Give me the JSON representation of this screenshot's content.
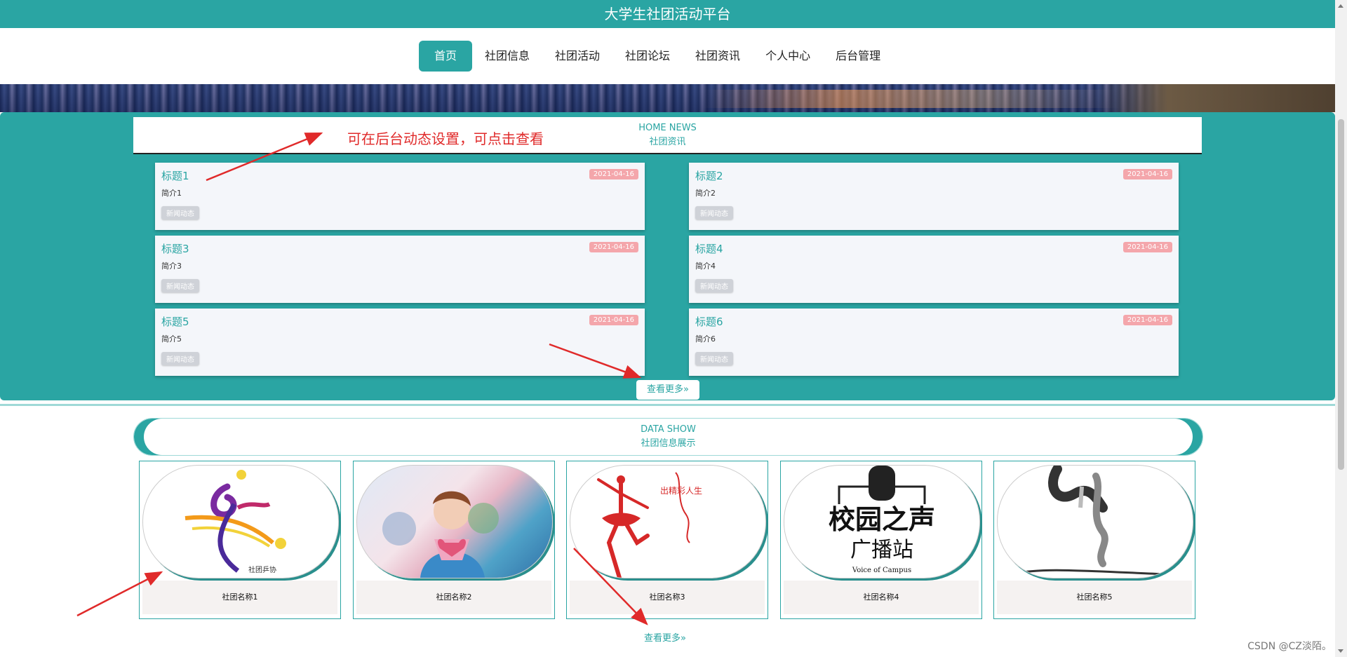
{
  "header": {
    "title": "大学生社团活动平台"
  },
  "nav": {
    "items": [
      {
        "label": "首页",
        "active": true
      },
      {
        "label": "社团信息"
      },
      {
        "label": "社团活动"
      },
      {
        "label": "社团论坛"
      },
      {
        "label": "社团资讯"
      },
      {
        "label": "个人中心"
      },
      {
        "label": "后台管理"
      }
    ]
  },
  "news": {
    "header_en": "HOME NEWS",
    "header_cn": "社团资讯",
    "annotation": "可在后台动态设置，可点击查看",
    "items": [
      {
        "title": "标题1",
        "date": "2021-04-16",
        "summary": "简介1",
        "tag": "新闻动态"
      },
      {
        "title": "标题2",
        "date": "2021-04-16",
        "summary": "简介2",
        "tag": "新闻动态"
      },
      {
        "title": "标题3",
        "date": "2021-04-16",
        "summary": "简介3",
        "tag": "新闻动态"
      },
      {
        "title": "标题4",
        "date": "2021-04-16",
        "summary": "简介4",
        "tag": "新闻动态"
      },
      {
        "title": "标题5",
        "date": "2021-04-16",
        "summary": "简介5",
        "tag": "新闻动态"
      },
      {
        "title": "标题6",
        "date": "2021-04-16",
        "summary": "简介6",
        "tag": "新闻动态"
      }
    ],
    "more_label": "查看更多»"
  },
  "clubs": {
    "header_en": "DATA SHOW",
    "header_cn": "社团信息展示",
    "items": [
      {
        "name": "社团名称1",
        "logo_text": "社团乒协"
      },
      {
        "name": "社团名称2"
      },
      {
        "name": "社团名称3",
        "logo_text": "出精彩人生"
      },
      {
        "name": "社团名称4",
        "logo_text": "校园之声",
        "logo_sub": "广播站",
        "logo_en": "Voice of Campus"
      },
      {
        "name": "社团名称5"
      }
    ],
    "more_label": "查看更多»"
  },
  "watermark": "CSDN @CZ淡陌。",
  "colors": {
    "primary": "#2aa5a3",
    "date_badge": "#f4a6ab",
    "annotation": "#e02a2a"
  }
}
